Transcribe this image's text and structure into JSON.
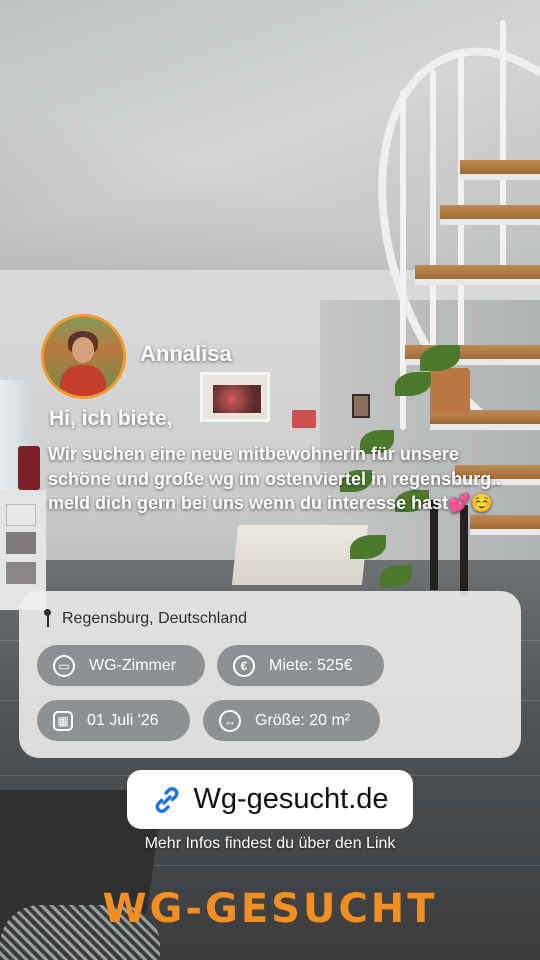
{
  "profile": {
    "name": "Annalisa"
  },
  "post": {
    "greeting": "Hi, ich biete,",
    "description": "Wir suchen eine neue mitbewohnerin für unsere schöne und große wg im ostenviertel in regensburg.. meld dich gern bei uns wenn du interesse hast💕☺️"
  },
  "listing": {
    "location": "Regensburg, Deutschland",
    "chips": [
      {
        "icon": "bed-icon",
        "label": "WG-Zimmer"
      },
      {
        "icon": "euro-icon",
        "label": "Miete: 525€"
      },
      {
        "icon": "calendar-icon",
        "label": "01 Juli '26"
      },
      {
        "icon": "size-icon",
        "label": "Größe: 20 m²"
      }
    ]
  },
  "link": {
    "label": "Wg-gesucht.de",
    "caption": "Mehr Infos findest du über den Link"
  },
  "brand": {
    "label": "WG-GESUCHT",
    "color": "#f28e22"
  }
}
